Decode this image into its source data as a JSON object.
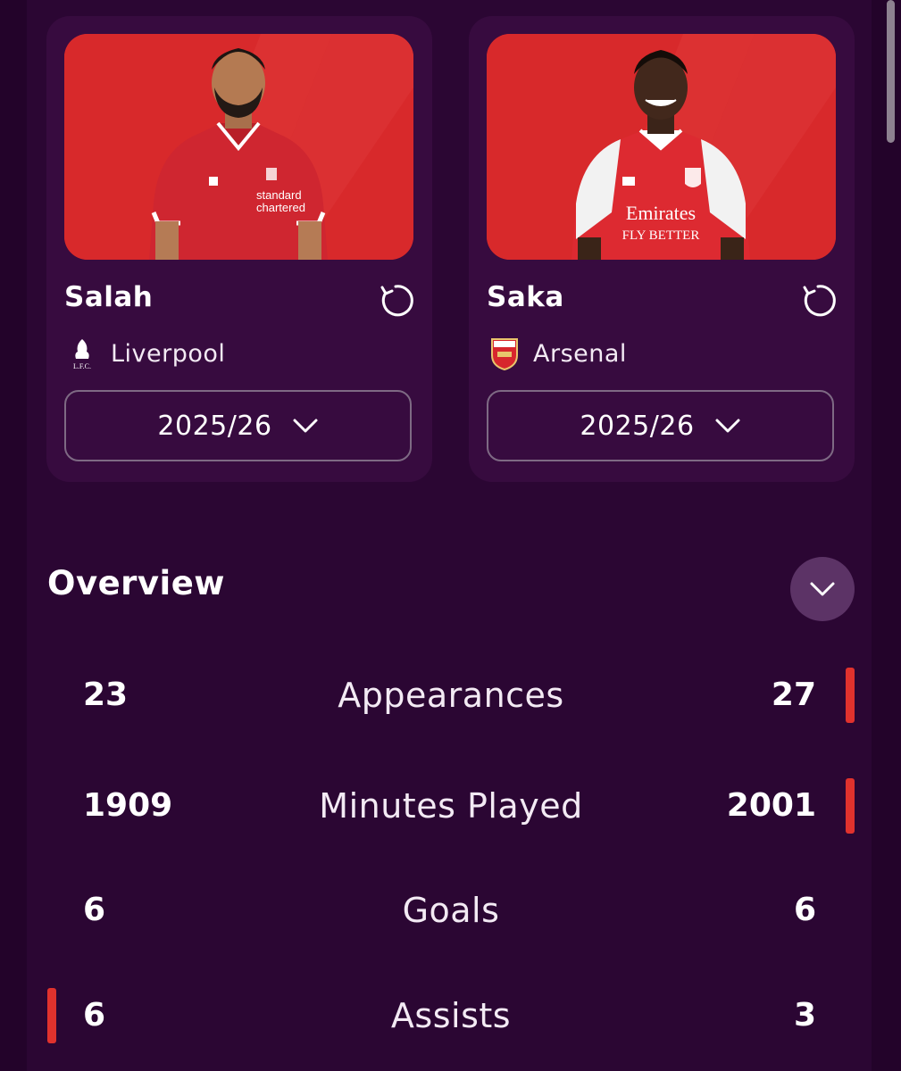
{
  "players": [
    {
      "name": "Salah",
      "club": "Liverpool",
      "season": "2025/26",
      "kit_color": "#d42a30",
      "kit_trim": "#ffffff",
      "sponsor_lines": [
        "standard",
        "chartered"
      ],
      "crest_icon": "liverpool-crest-icon"
    },
    {
      "name": "Saka",
      "club": "Arsenal",
      "season": "2025/26",
      "kit_color": "#e02a30",
      "kit_trim": "#ffffff",
      "sponsor_lines": [
        "Emirates",
        "FLY BETTER"
      ],
      "crest_icon": "arsenal-crest-icon"
    }
  ],
  "overview": {
    "title": "Overview",
    "stats": [
      {
        "label": "Appearances",
        "left": "23",
        "right": "27",
        "leader": "right"
      },
      {
        "label": "Minutes Played",
        "left": "1909",
        "right": "2001",
        "leader": "right"
      },
      {
        "label": "Goals",
        "left": "6",
        "right": "6",
        "leader": "none"
      },
      {
        "label": "Assists",
        "left": "6",
        "right": "3",
        "leader": "left"
      }
    ]
  },
  "colors": {
    "background": "#23032a",
    "card": "#370b3f",
    "accent_leader": "#e0322d",
    "photo_bg": "#d92b2b"
  }
}
